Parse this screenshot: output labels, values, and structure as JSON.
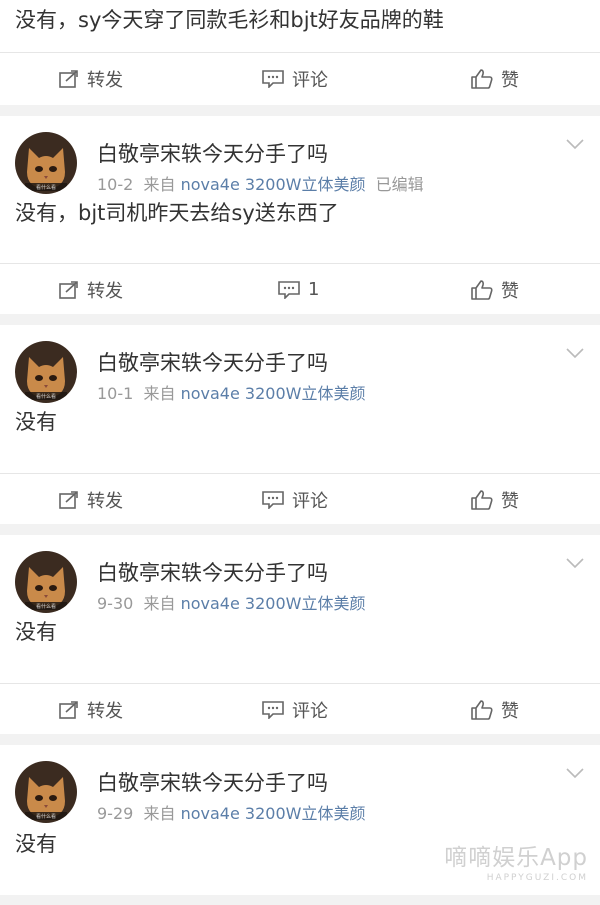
{
  "top_post": {
    "content": "没有，sy今天穿了同款毛衫和bjt好友品牌的鞋",
    "forward": "转发",
    "comment": "评论",
    "like": "赞"
  },
  "posts": [
    {
      "username": "白敬亭宋轶今天分手了吗",
      "date": "10-2",
      "from": "来自",
      "device": "nova4e 3200W立体美颜",
      "edited": "已编辑",
      "content": "没有，bjt司机昨天去给sy送东西了",
      "forward": "转发",
      "comment": "1",
      "like": "赞"
    },
    {
      "username": "白敬亭宋轶今天分手了吗",
      "date": "10-1",
      "from": "来自",
      "device": "nova4e 3200W立体美颜",
      "content": "没有",
      "forward": "转发",
      "comment": "评论",
      "like": "赞"
    },
    {
      "username": "白敬亭宋轶今天分手了吗",
      "date": "9-30",
      "from": "来自",
      "device": "nova4e 3200W立体美颜",
      "content": "没有",
      "forward": "转发",
      "comment": "评论",
      "like": "赞"
    },
    {
      "username": "白敬亭宋轶今天分手了吗",
      "date": "9-29",
      "from": "来自",
      "device": "nova4e 3200W立体美颜",
      "content": "没有"
    }
  ],
  "watermark": {
    "main": "嘀嘀娱乐App",
    "sub": "HAPPYGUZI.COM"
  },
  "colors": {
    "link": "#5b7ea8",
    "meta": "#999999",
    "separator": "#f2f2f2"
  },
  "icons": [
    "forward-icon",
    "comment-icon",
    "like-icon",
    "chevron-down-icon",
    "avatar-cat"
  ]
}
